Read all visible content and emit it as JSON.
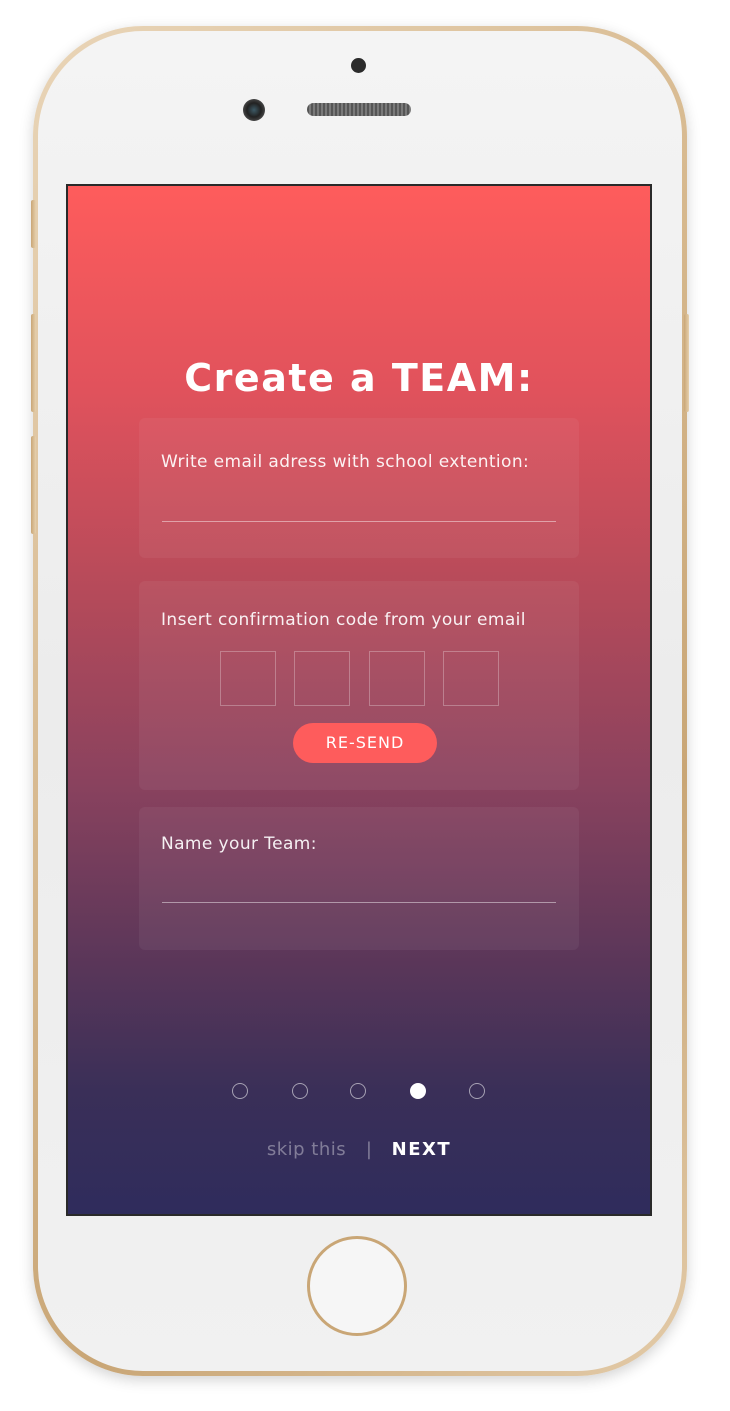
{
  "colors": {
    "gradient_top": "#fe5c5c",
    "gradient_bottom": "#2f2c5c",
    "accent": "#fe5c5c",
    "phone_frame": "#d7b98f"
  },
  "screen": {
    "title": "Create a TEAM:",
    "email_card": {
      "label": "Write email adress with school extention:",
      "value": ""
    },
    "code_card": {
      "label": "Insert confirmation code from your email",
      "digits": [
        "",
        "",
        "",
        ""
      ],
      "resend_label": "RE-SEND"
    },
    "team_card": {
      "label": "Name your Team:",
      "value": ""
    },
    "pagination": {
      "total": 5,
      "active_index": 3
    },
    "footer": {
      "skip_label": "skip this",
      "separator": "|",
      "next_label": "NEXT"
    }
  }
}
